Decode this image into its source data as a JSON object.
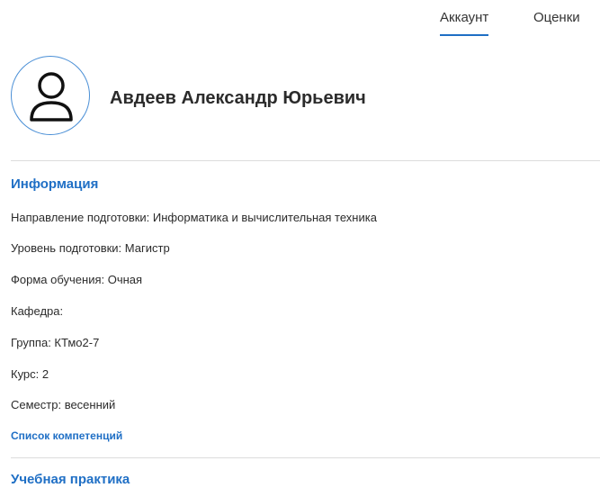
{
  "nav": {
    "tabs": [
      {
        "label": "Аккаунт",
        "active": true
      },
      {
        "label": "Оценки",
        "active": false
      }
    ],
    "accent_color": "#1f6fc5"
  },
  "profile": {
    "avatar_icon": "user-icon",
    "name": "Авдеев Александр Юрьевич"
  },
  "info": {
    "title": "Информация",
    "rows": [
      "Направление подготовки: Информатика и вычислительная техника",
      "Уровень подготовки: Магистр",
      "Форма обучения: Очная",
      "Кафедра:",
      "Группа: КТмо2-7",
      "Курс: 2",
      "Семестр: весенний"
    ],
    "competencies_link": "Список компетенций"
  },
  "practice": {
    "title": "Учебная практика"
  }
}
